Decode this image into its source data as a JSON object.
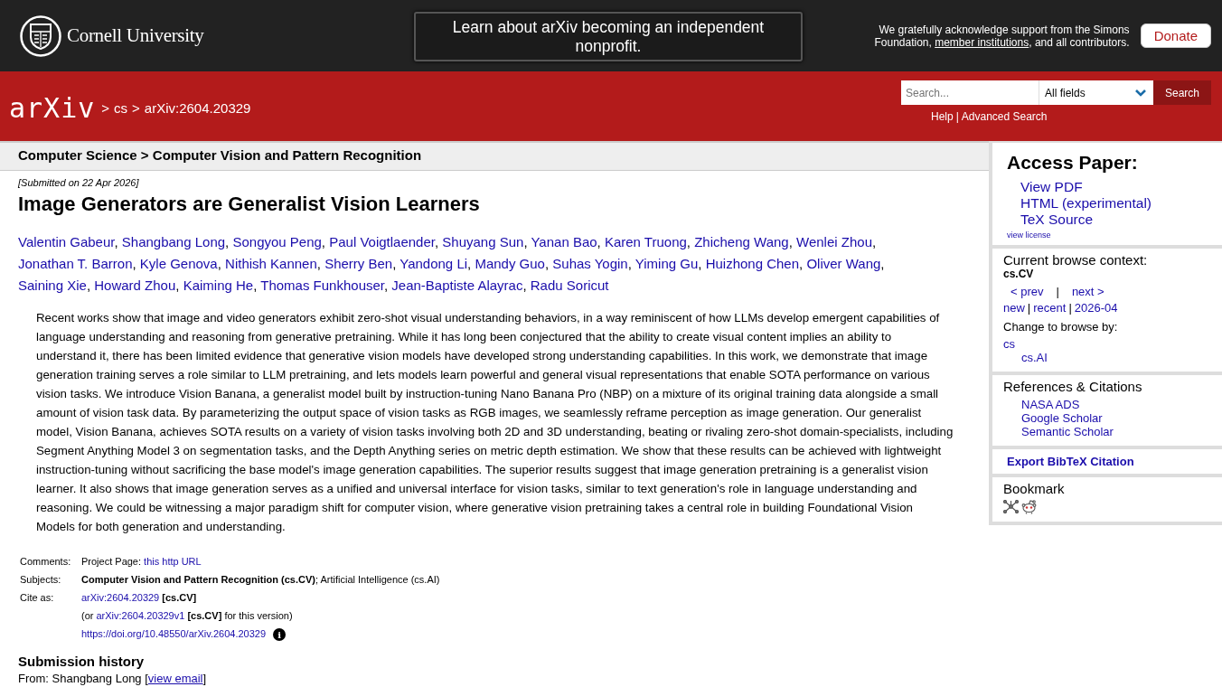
{
  "banner": {
    "university": "Cornell University",
    "notice": "Learn about arXiv becoming an independent nonprofit.",
    "support": {
      "before": "We gratefully acknowledge support from the Simons Foundation, ",
      "link": "member institutions",
      "after": ", and all contributors."
    },
    "donate": "Donate"
  },
  "header": {
    "logo": "arXiv",
    "breadcrumb": {
      "separator": ">",
      "links": [
        "cs",
        "arXiv:2604.20329"
      ]
    },
    "search": {
      "placeholder": "Search...",
      "field": "All fields",
      "button": "Search"
    },
    "links": {
      "separator": "|",
      "links": [
        "Help",
        "Advanced Search"
      ]
    }
  },
  "subheader": "Computer Science > Computer Vision and Pattern Recognition",
  "dateline": "[Submitted on 22 Apr 2026]",
  "title": "Image Generators are Generalist Vision Learners",
  "authors": [
    {
      "name": "Valentin Gabeur",
      "separator": ","
    },
    {
      "name": "Shangbang Long",
      "separator": ","
    },
    {
      "name": "Songyou Peng",
      "separator": ","
    },
    {
      "name": "Paul Voigtlaender",
      "separator": ","
    },
    {
      "name": "Shuyang Sun",
      "separator": ","
    },
    {
      "name": "Yanan Bao",
      "separator": ","
    },
    {
      "name": "Karen Truong",
      "separator": ","
    },
    {
      "name": "Zhicheng Wang",
      "separator": ","
    },
    {
      "name": "Wenlei Zhou",
      "separator": ","
    },
    {
      "name": "Jonathan T. Barron",
      "separator": ","
    },
    {
      "name": "Kyle Genova",
      "separator": ","
    },
    {
      "name": "Nithish Kannen",
      "separator": ","
    },
    {
      "name": "Sherry Ben",
      "separator": ","
    },
    {
      "name": "Yandong Li",
      "separator": ","
    },
    {
      "name": "Mandy Guo",
      "separator": ","
    },
    {
      "name": "Suhas Yogin",
      "separator": ","
    },
    {
      "name": "Yiming Gu",
      "separator": ","
    },
    {
      "name": "Huizhong Chen",
      "separator": ","
    },
    {
      "name": "Oliver Wang",
      "separator": ","
    },
    {
      "name": "Saining Xie",
      "separator": ","
    },
    {
      "name": "Howard Zhou",
      "separator": ","
    },
    {
      "name": "Kaiming He",
      "separator": ","
    },
    {
      "name": "Thomas Funkhouser",
      "separator": ","
    },
    {
      "name": "Jean-Baptiste Alayrac",
      "separator": ","
    },
    {
      "name": "Radu Soricut"
    }
  ],
  "abstract": "Recent works show that image and video generators exhibit zero-shot visual understanding behaviors, in a way reminiscent of how LLMs develop emergent capabilities of language understanding and reasoning from generative pretraining. While it has long been conjectured that the ability to create visual content implies an ability to understand it, there has been limited evidence that generative vision models have developed strong understanding capabilities. In this work, we demonstrate that image generation training serves a role similar to LLM pretraining, and lets models learn powerful and general visual representations that enable SOTA performance on various vision tasks. We introduce Vision Banana, a generalist model built by instruction-tuning Nano Banana Pro (NBP) on a mixture of its original training data alongside a small amount of vision task data. By parameterizing the output space of vision tasks as RGB images, we seamlessly reframe perception as image generation. Our generalist model, Vision Banana, achieves SOTA results on a variety of vision tasks involving both 2D and 3D understanding, beating or rivaling zero-shot domain-specialists, including Segment Anything Model 3 on segmentation tasks, and the Depth Anything series on metric depth estimation. We show that these results can be achieved with lightweight instruction-tuning without sacrificing the base model's image generation capabilities. The superior results suggest that image generation pretraining is a generalist vision learner. It also shows that image generation serves as a unified and universal interface for vision tasks, similar to text generation's role in language understanding and reasoning. We could be witnessing a major paradigm shift for computer vision, where generative vision pretraining takes a central role in building Foundational Vision Models for both generation and understanding.",
  "metatable": [
    {
      "label": "Comments:",
      "lines": [
        [
          {
            "kind": "text",
            "text": "Project Page: "
          },
          {
            "kind": "link",
            "text": "this http URL"
          }
        ]
      ]
    },
    {
      "label": "Subjects:",
      "lines": [
        [
          {
            "kind": "bold",
            "text": "Computer Vision and Pattern Recognition (cs.CV)"
          },
          {
            "kind": "text",
            "text": "; Artificial Intelligence (cs.AI)"
          }
        ]
      ]
    },
    {
      "label": "Cite as:",
      "lines": [
        [
          {
            "kind": "link",
            "text": "arXiv:2604.20329"
          },
          {
            "kind": "bold",
            "text": " [cs.CV]"
          }
        ],
        [
          {
            "kind": "text",
            "text": "(or "
          },
          {
            "kind": "link",
            "text": "arXiv:2604.20329v1"
          },
          {
            "kind": "bold",
            "text": " [cs.CV]"
          },
          {
            "kind": "text",
            "text": " for this version)"
          }
        ],
        [
          {
            "kind": "link",
            "text": "https://doi.org/10.48550/arXiv.2604.20329"
          },
          {
            "kind": "info",
            "text": "i"
          }
        ]
      ]
    }
  ],
  "history": {
    "heading": "Submission history",
    "from": {
      "before": "From: Shangbang Long [",
      "link": "view email",
      "after": "]"
    }
  },
  "sidebar": {
    "access": {
      "heading": "Access Paper:",
      "links": [
        "View PDF",
        "HTML (experimental)",
        "TeX Source"
      ],
      "license": "view license"
    },
    "browse": {
      "heading": "Current browse context:",
      "context": "cs.CV",
      "nav": {
        "separator": "|",
        "links": [
          "< prev",
          "next >"
        ]
      },
      "lists": {
        "separator": "|",
        "links": [
          "new",
          "recent",
          "2026-04"
        ]
      },
      "change": "Change to browse by:",
      "categories": [
        {
          "text": "cs",
          "children": [
            {
              "text": "cs.AI"
            }
          ]
        }
      ]
    },
    "references": {
      "heading": "References & Citations",
      "links": [
        "NASA ADS",
        "Google Scholar",
        "Semantic Scholar"
      ]
    },
    "export": "Export BibTeX Citation",
    "bookmark": {
      "heading": "Bookmark",
      "icons": [
        {
          "kind": "network"
        },
        {
          "kind": "alien"
        }
      ]
    }
  }
}
